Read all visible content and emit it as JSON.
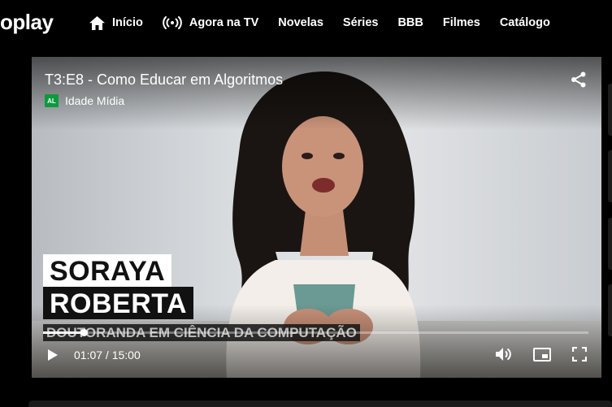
{
  "brand": {
    "logo_text": "oplay"
  },
  "nav": [
    {
      "label": "Início",
      "icon": "home-icon"
    },
    {
      "label": "Agora na TV",
      "icon": "live-broadcast-icon"
    },
    {
      "label": "Novelas"
    },
    {
      "label": "Séries"
    },
    {
      "label": "BBB"
    },
    {
      "label": "Filmes"
    },
    {
      "label": "Catálogo"
    }
  ],
  "player": {
    "episode_title": "T3:E8 - Como Educar em Algoritmos",
    "rating_badge": "AL",
    "rating_badge_color": "#0c9a3e",
    "rating_label": "Idade Mídia",
    "lower_third": {
      "line1": "SORAYA",
      "line2": "ROBERTA",
      "line3": "DOUTORANDA EM CIÊNCIA DA COMPUTAÇÃO"
    },
    "time_display": "01:07 / 15:00",
    "progress_fraction": 0.074,
    "icons": [
      "share-icon",
      "play-icon",
      "volume-icon",
      "picture-in-picture-icon",
      "fullscreen-icon"
    ]
  }
}
